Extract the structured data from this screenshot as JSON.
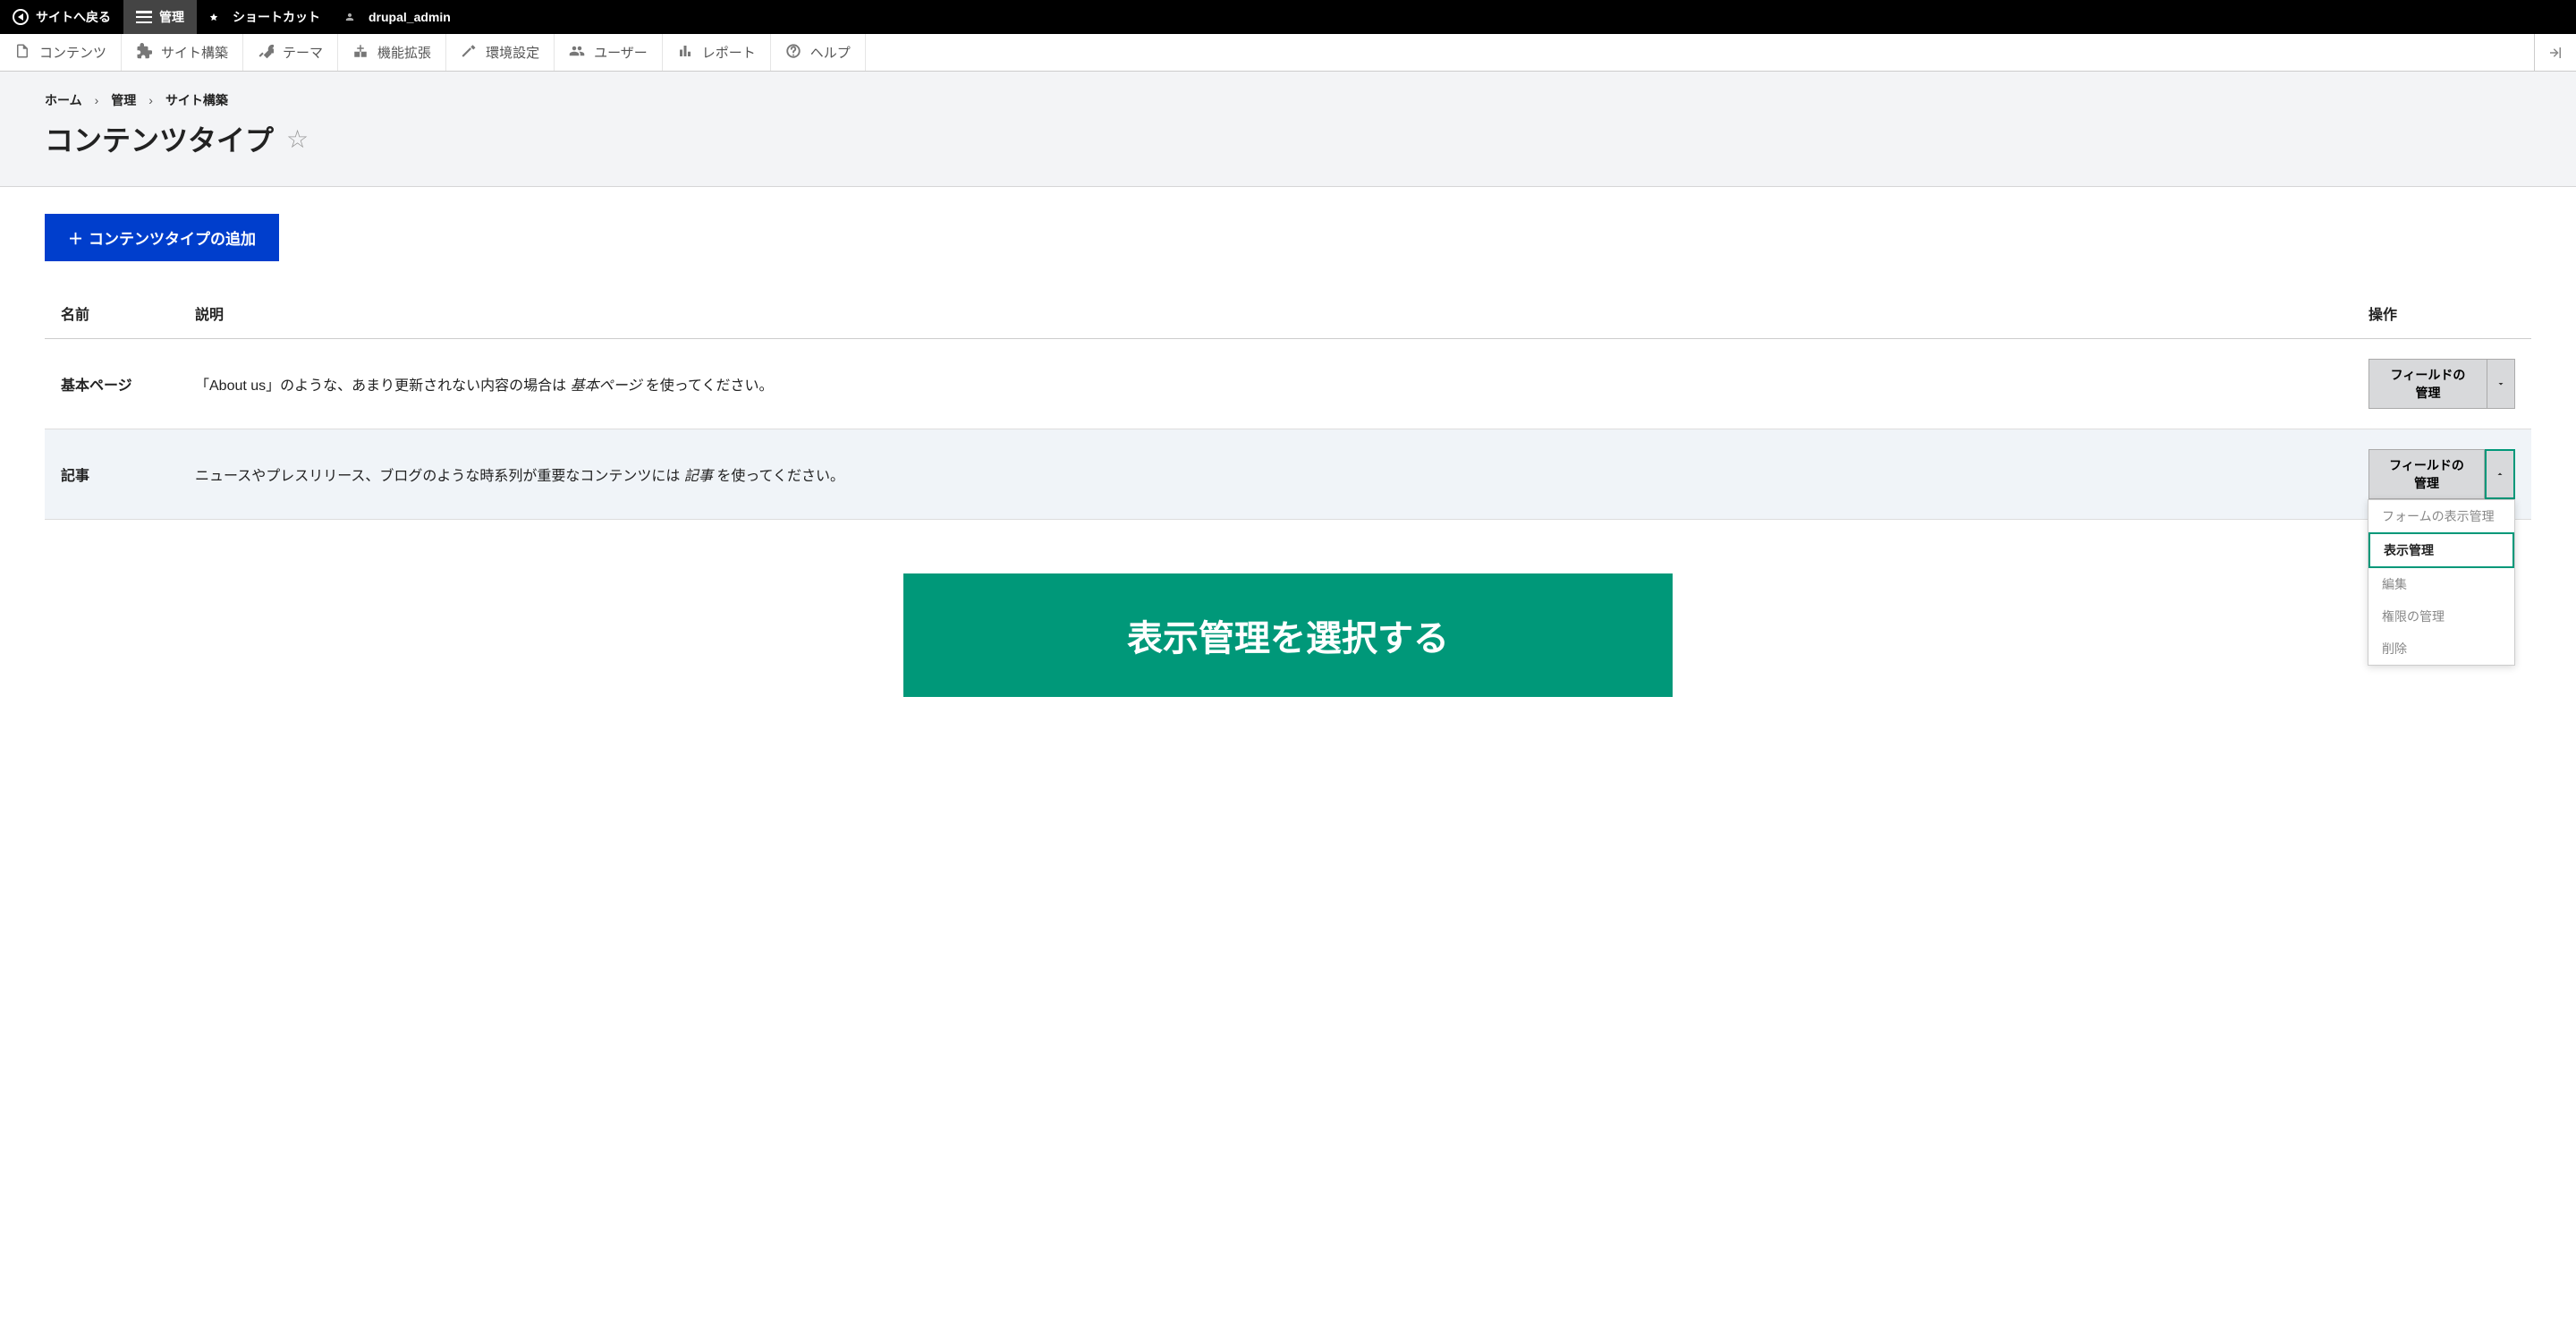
{
  "topbar": {
    "back_to_site": "サイトへ戻る",
    "manage": "管理",
    "shortcuts": "ショートカット",
    "user": "drupal_admin"
  },
  "admin_toolbar": {
    "items": [
      {
        "label": "コンテンツ",
        "icon": "file-icon"
      },
      {
        "label": "サイト構築",
        "icon": "puzzle-icon"
      },
      {
        "label": "テーマ",
        "icon": "wrench-icon"
      },
      {
        "label": "機能拡張",
        "icon": "plugin-icon"
      },
      {
        "label": "環境設定",
        "icon": "spanner-icon"
      },
      {
        "label": "ユーザー",
        "icon": "users-icon"
      },
      {
        "label": "レポート",
        "icon": "chart-icon"
      },
      {
        "label": "ヘルプ",
        "icon": "help-icon"
      }
    ]
  },
  "breadcrumb": {
    "home": "ホーム",
    "manage": "管理",
    "structure": "サイト構築"
  },
  "page_title": "コンテンツタイプ",
  "add_button_label": "コンテンツタイプの追加",
  "table": {
    "headers": {
      "name": "名前",
      "description": "説明",
      "operations": "操作"
    },
    "rows": [
      {
        "name": "基本ページ",
        "description_prefix": "「About us」のような、あまり更新されない内容の場合は ",
        "description_italic": "基本ページ",
        "description_suffix": " を使ってください。",
        "op_label": "フィールドの管理",
        "dropdown_open": false
      },
      {
        "name": "記事",
        "description_prefix": "ニュースやプレスリリース、ブログのような時系列が重要なコンテンツには ",
        "description_italic": "記事",
        "description_suffix": " を使ってください。",
        "op_label": "フィールドの管理",
        "dropdown_open": true
      }
    ]
  },
  "dropdown": {
    "items": [
      "フォームの表示管理",
      "表示管理",
      "編集",
      "権限の管理",
      "削除"
    ],
    "highlighted_index": 1
  },
  "callout_text": "表示管理を選択する"
}
